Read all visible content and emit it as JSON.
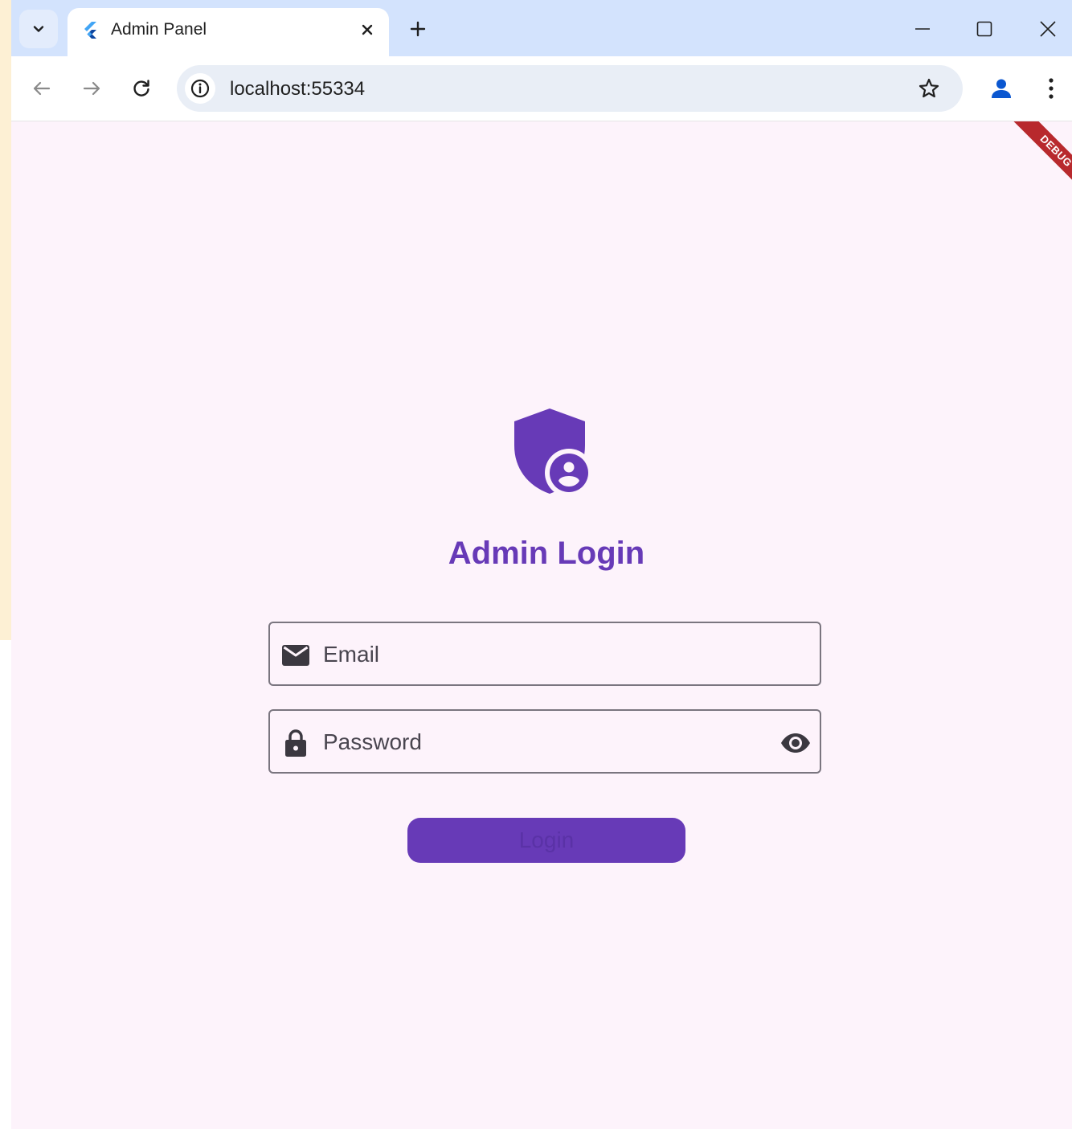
{
  "browser": {
    "tab": {
      "title": "Admin Panel",
      "favicon": "flutter-icon"
    },
    "address_bar": {
      "url": "localhost:55334"
    },
    "icons": {
      "tab_search": "chevron-down-icon",
      "new_tab": "plus-icon",
      "minimize": "minimize-icon",
      "maximize": "maximize-icon",
      "close": "close-icon",
      "back": "arrow-left-icon",
      "forward": "arrow-right-icon",
      "reload": "reload-icon",
      "site_info": "info-icon",
      "bookmark": "star-icon",
      "profile": "person-icon",
      "menu": "kebab-menu-icon"
    }
  },
  "app": {
    "debug_banner": "DEBUG",
    "logo_icon": "admin-shield-icon",
    "title": "Admin Login",
    "email_field": {
      "placeholder": "Email",
      "value": "",
      "icon": "mail-icon"
    },
    "password_field": {
      "placeholder": "Password",
      "value": "",
      "icon": "lock-icon",
      "toggle_icon": "eye-icon"
    },
    "login_button": {
      "label": "Login"
    }
  },
  "colors": {
    "primary": "#673ab7",
    "background": "#fdf3fb",
    "tabstrip": "#d3e3fd",
    "omnibox": "#e9eef6",
    "debug_banner": "#b8292d",
    "field_border": "#7a757f"
  }
}
